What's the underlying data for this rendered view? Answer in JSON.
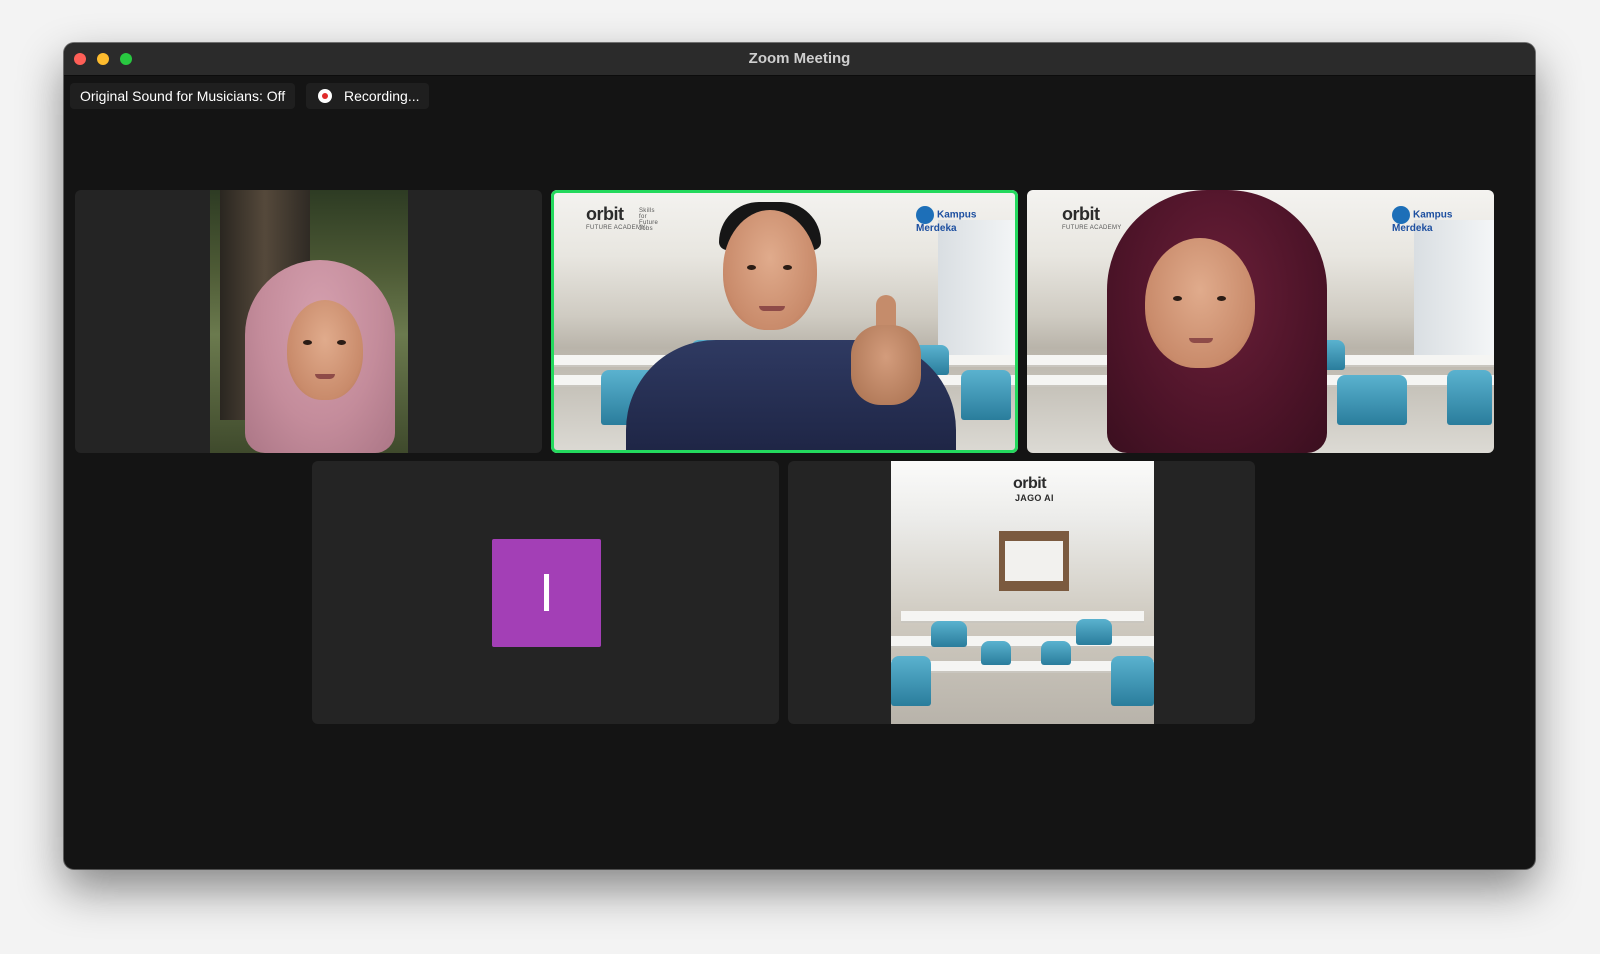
{
  "window": {
    "title": "Zoom Meeting"
  },
  "status_bar": {
    "original_sound": "Original Sound for Musicians: Off",
    "recording": "Recording..."
  },
  "participants": [
    {
      "type": "video",
      "scene": "outdoor"
    },
    {
      "type": "video",
      "scene": "classroom",
      "active_speaker": true
    },
    {
      "type": "video",
      "scene": "classroom"
    },
    {
      "type": "avatar",
      "initial": "I",
      "avatar_color": "#a33fb6"
    },
    {
      "type": "video",
      "scene": "empty-classroom"
    }
  ],
  "backgrounds": {
    "orbit_logo": "orbit",
    "orbit_tagline": "FUTURE ACADEMY",
    "orbit_skills": "Skills for Future Jobs",
    "kampus_logo": "Kampus Merdeka",
    "jago_logo": "orbit",
    "jago_sub": "JAGO AI"
  },
  "colors": {
    "active_speaker_border": "#23d95d",
    "recording_dot": "#e02a2a",
    "window_bg": "#141414",
    "tile_bg": "#242424"
  },
  "icons": [
    "close-icon",
    "minimize-icon",
    "maximize-icon",
    "recording-icon"
  ]
}
